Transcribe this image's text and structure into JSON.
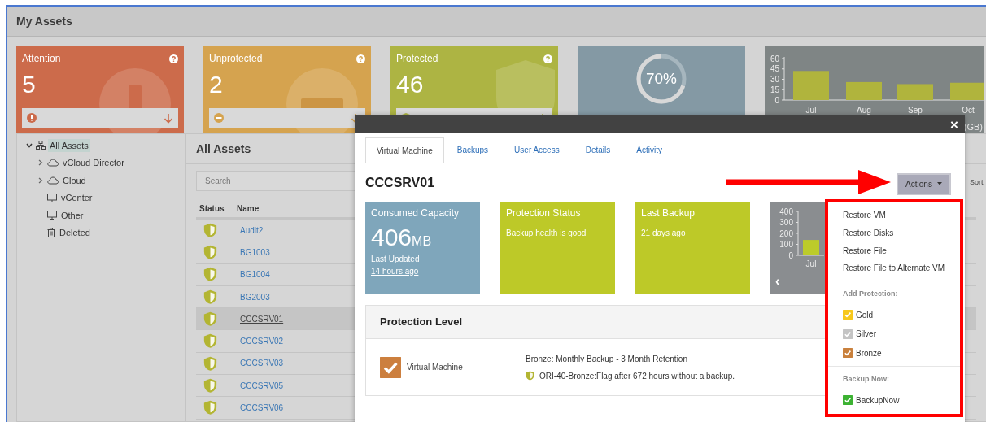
{
  "header": {
    "title": "My Assets"
  },
  "summary_tiles": [
    {
      "kind": "attention",
      "label": "Attention",
      "count": "5"
    },
    {
      "kind": "unprotected",
      "label": "Unprotected",
      "count": "2"
    },
    {
      "kind": "protected",
      "label": "Protected",
      "count": "46"
    }
  ],
  "storage_tile": {
    "percent": "70%",
    "level": 0.7
  },
  "usage_tile": {
    "caption": "(GB)",
    "chart_data": {
      "type": "bar",
      "categories": [
        "Jul",
        "Aug",
        "Sep",
        "Oct"
      ],
      "values": [
        42,
        26,
        23,
        25
      ],
      "yticks": [
        0,
        15,
        30,
        45,
        60
      ],
      "ylim": [
        0,
        60
      ]
    }
  },
  "tree": {
    "items": [
      {
        "label": "All Assets",
        "kind": "network",
        "selected": true,
        "expanded": true,
        "children": [
          {
            "label": "vCloud Director",
            "kind": "cloud",
            "selected": false,
            "expanded": false
          },
          {
            "label": "Cloud",
            "kind": "cloud",
            "selected": false,
            "expanded": false
          },
          {
            "label": "vCenter",
            "kind": "monitor",
            "selected": false
          },
          {
            "label": "Other",
            "kind": "monitor",
            "selected": false
          },
          {
            "label": "Deleted",
            "kind": "trash",
            "selected": false
          }
        ]
      }
    ]
  },
  "assets": {
    "title": "All Assets",
    "search": {
      "placeholder": "Search"
    },
    "sort_label": "Sort",
    "columns": [
      "Status",
      "Name"
    ],
    "rows": [
      {
        "name": "Audit2",
        "selected": false
      },
      {
        "name": "BG1003",
        "selected": false
      },
      {
        "name": "BG1004",
        "selected": false
      },
      {
        "name": "BG2003",
        "selected": false
      },
      {
        "name": "CCCSRV01",
        "selected": true
      },
      {
        "name": "CCCSRV02",
        "selected": false
      },
      {
        "name": "CCCSRV03",
        "selected": false
      },
      {
        "name": "CCCSRV05",
        "selected": false
      },
      {
        "name": "CCCSRV06",
        "selected": false
      }
    ]
  },
  "modal": {
    "close": "×",
    "tabs": [
      {
        "label": "Virtual Machine",
        "selected": true
      },
      {
        "label": "Backups",
        "selected": false
      },
      {
        "label": "User Access",
        "selected": false
      },
      {
        "label": "Details",
        "selected": false
      },
      {
        "label": "Activity",
        "selected": false
      }
    ],
    "title": "CCCSRV01",
    "actions_button": "Actions",
    "tiles": [
      {
        "kind": "capacity",
        "title": "Consumed Capacity",
        "value": "406",
        "unit": "MB",
        "note": "Last Updated",
        "link": "14 hours ago"
      },
      {
        "kind": "status",
        "title": "Protection Status",
        "text": "Backup health is good"
      },
      {
        "kind": "backup",
        "title": "Last Backup",
        "link": "21 days ago"
      }
    ],
    "mini_chart": {
      "prev": "‹",
      "chart_data": {
        "type": "bar",
        "categories": [
          "Jul"
        ],
        "values": [
          140
        ],
        "yticks": [
          0,
          100,
          200,
          300,
          400
        ],
        "ylim": [
          0,
          400
        ]
      }
    },
    "protection_level": {
      "title": "Protection Level",
      "checked": true,
      "label": "Virtual Machine",
      "policy": "Bronze: Monthly Backup - 3 Month Retention",
      "rule": "ORI-40-Bronze:Flag after 672 hours without a backup."
    }
  },
  "actions_menu": {
    "items": [
      "Restore VM",
      "Restore Disks",
      "Restore File",
      "Restore File to Alternate VM"
    ],
    "sections": [
      {
        "heading": "Add Protection:",
        "options": [
          {
            "label": "Gold",
            "color": "#f7c81c",
            "checked": true
          },
          {
            "label": "Silver",
            "color": "#c4c4c4",
            "checked": true
          },
          {
            "label": "Bronze",
            "color": "#c9803c",
            "checked": true
          }
        ]
      },
      {
        "heading": "Backup Now:",
        "options": [
          {
            "label": "BackupNow",
            "color": "#3cb233",
            "checked": true
          }
        ]
      }
    ]
  }
}
